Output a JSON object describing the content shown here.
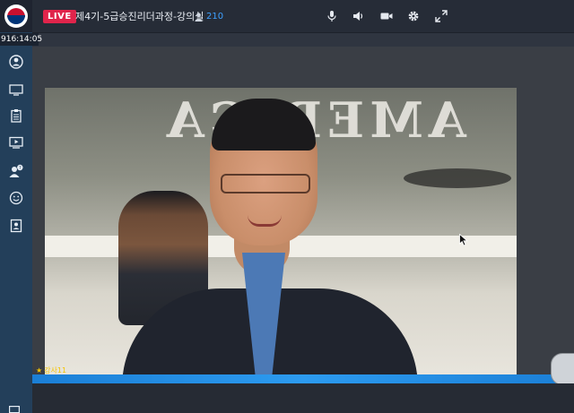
{
  "header": {
    "live_label": "LIVE",
    "title": "제4기-5급승진리더과정-강의실",
    "viewer_count": "210"
  },
  "sidebar": {
    "timestamp": "916:14:05",
    "items": [
      {
        "name": "profile",
        "icon": "user-circle-icon"
      },
      {
        "name": "screen",
        "icon": "monitor-icon"
      },
      {
        "name": "clipboard",
        "icon": "clipboard-icon"
      },
      {
        "name": "video",
        "icon": "play-screen-icon"
      },
      {
        "name": "qna",
        "icon": "user-question-icon"
      },
      {
        "name": "emoji",
        "icon": "smile-icon"
      },
      {
        "name": "contact",
        "icon": "contact-card-icon"
      }
    ]
  },
  "controls": [
    {
      "name": "microphone",
      "icon": "microphone-icon"
    },
    {
      "name": "volume",
      "icon": "speaker-icon"
    },
    {
      "name": "camera",
      "icon": "camera-icon"
    },
    {
      "name": "settings",
      "icon": "gear-icon"
    },
    {
      "name": "fullscreen",
      "icon": "expand-icon"
    }
  ],
  "video": {
    "slide_text": "AMERICA",
    "speaker_label": "강사11"
  },
  "colors": {
    "live_badge": "#e0244b",
    "viewer_count": "#3ea0ff",
    "sidebar": "#233f5a",
    "accent_strip": "#2c9bf0",
    "speaker_label": "#f5c400"
  }
}
